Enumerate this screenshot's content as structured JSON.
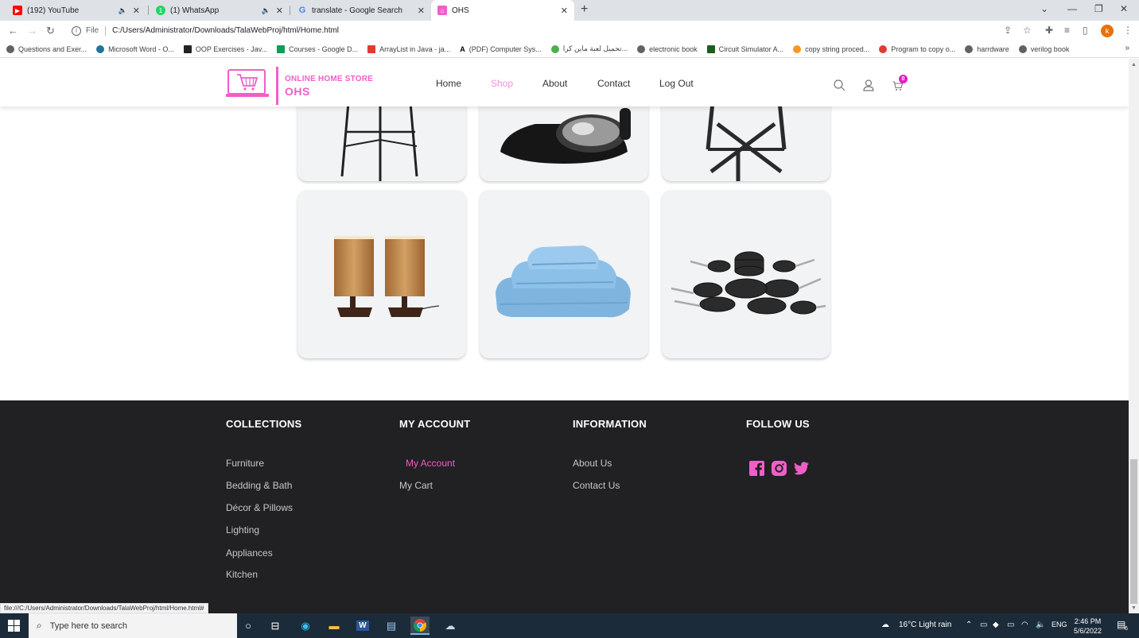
{
  "browser": {
    "tabs": [
      {
        "title": "(192) YouTube",
        "icon": "youtube-icon",
        "color": "#ff0000"
      },
      {
        "title": "(1) WhatsApp",
        "icon": "whatsapp-icon",
        "color": "#25d366"
      },
      {
        "title": "translate - Google Search",
        "icon": "google-icon",
        "color": "#4285f4"
      },
      {
        "title": "OHS",
        "icon": "ohs-favicon",
        "color": "#f25ec9"
      }
    ],
    "address": {
      "scheme": "File",
      "url": "C:/Users/Administrator/Downloads/TalaWebProj/html/Home.html"
    },
    "profile_initial": "k",
    "bookmarks": [
      "Questions and Exer...",
      "Microsoft Word - O...",
      "OOP Exercises - Jav...",
      "Courses - Google D...",
      "ArrayList in Java - ja...",
      "(PDF) Computer Sys...",
      "تحميل لعبة ماين كرا...",
      "electronic book",
      "Circuit Simulator A...",
      "copy string proced...",
      "Program to copy o...",
      "harrdware",
      "verilog book"
    ],
    "bookmarks_more": "»",
    "status_link": "file:///C:/Users/Administrator/Downloads/TalaWebProj/html/Home.html#"
  },
  "site": {
    "logo_line1": "ONLINE HOME STORE",
    "logo_line2": "OHS",
    "brand_color": "#f25ec9",
    "nav": [
      {
        "label": "Home",
        "active": false
      },
      {
        "label": "Shop",
        "active": true
      },
      {
        "label": "About",
        "active": false
      },
      {
        "label": "Contact",
        "active": false
      },
      {
        "label": "Log Out",
        "active": false
      }
    ],
    "cart_count": "0"
  },
  "products": [
    {
      "name": "bar-stool",
      "icon": "stool-icon"
    },
    {
      "name": "stand-mixer",
      "icon": "mixer-icon"
    },
    {
      "name": "side-table",
      "icon": "table-icon"
    },
    {
      "name": "table-lamps",
      "icon": "lamp-icon"
    },
    {
      "name": "towel-set",
      "icon": "towel-icon"
    },
    {
      "name": "cookware-set",
      "icon": "cookware-icon"
    }
  ],
  "footer": {
    "collections": {
      "heading": "COLLECTIONS",
      "links": [
        "Furniture",
        "Bedding & Bath",
        "Décor & Pillows",
        "Lighting",
        "Appliances",
        "Kitchen"
      ]
    },
    "account": {
      "heading": "MY ACCOUNT",
      "links": [
        "My Account",
        "My Cart"
      ]
    },
    "information": {
      "heading": "INFORMATION",
      "links": [
        "About Us",
        "Contact Us"
      ]
    },
    "follow": {
      "heading": "FOLLOW US",
      "icons": [
        "facebook-icon",
        "instagram-icon",
        "twitter-icon"
      ]
    }
  },
  "taskbar": {
    "search_placeholder": "Type here to search",
    "weather": "16°C  Light rain",
    "language": "ENG",
    "time": "2:46 PM",
    "date": "5/6/2022",
    "notification_count": "6"
  }
}
